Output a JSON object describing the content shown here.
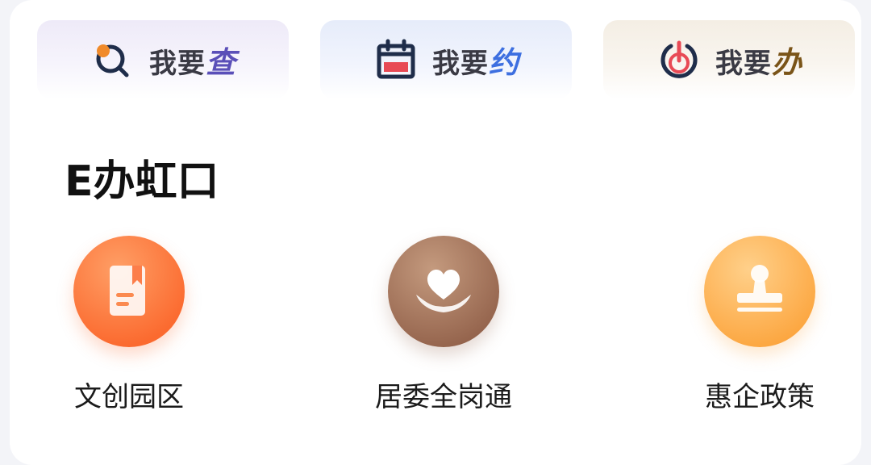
{
  "quick_actions": [
    {
      "prefix": "我要",
      "highlight": "查",
      "icon": "search-icon",
      "color": "#5a4fb8"
    },
    {
      "prefix": "我要",
      "highlight": "约",
      "icon": "calendar-icon",
      "color": "#3d6fe0"
    },
    {
      "prefix": "我要",
      "highlight": "办",
      "icon": "power-icon",
      "color": "#7a5418"
    }
  ],
  "section": {
    "title": "E办虹口"
  },
  "services": [
    {
      "label": "文创园区",
      "icon": "document-bookmark-icon",
      "color": "#fb6a2f"
    },
    {
      "label": "居委全岗通",
      "icon": "heart-hands-icon",
      "color": "#93624b"
    },
    {
      "label": "惠企政策",
      "icon": "stamp-icon",
      "color": "#fca53e"
    }
  ]
}
